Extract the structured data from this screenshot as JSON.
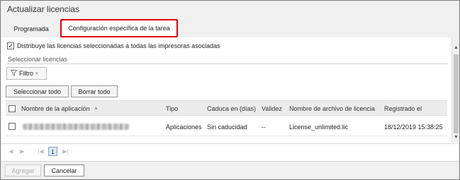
{
  "window": {
    "title": "Actualizar licencias"
  },
  "tabs": [
    {
      "label": "Programada"
    },
    {
      "label": "Configuración específica de la tarea"
    }
  ],
  "options": {
    "distribute_checked": true,
    "distribute_label": "Distribuye las licencias seleccionadas a todas las impresoras asociadas",
    "section_label": "Seleccionar licencias"
  },
  "filter": {
    "label": "Filtro"
  },
  "buttons": {
    "select_all": "Seleccionar todo",
    "clear_all": "Borrar todo"
  },
  "table": {
    "columns": [
      "Nombre de la aplicación",
      "Tipo",
      "Caduca en (días)",
      "Validez",
      "Nombre de archivo de licencia",
      "Registrado el"
    ],
    "rows": [
      {
        "app_name": "",
        "type": "Aplicaciones",
        "expires": "Sin caducidad",
        "validity": "--",
        "license_file": "License_unlimited.lic",
        "registered": "18/12/2019 15:38:25"
      }
    ]
  },
  "pager": {
    "current_page": "1"
  },
  "footer": {
    "add_label": "Agregar",
    "cancel_label": "Cancelar"
  },
  "colors": {
    "highlight_border": "#e10000",
    "header_bg": "#f0f0f0"
  },
  "icons": [
    "filter-icon",
    "dropdown-icon",
    "sort-asc-icon",
    "scroll-up-icon",
    "scroll-down-icon"
  ]
}
